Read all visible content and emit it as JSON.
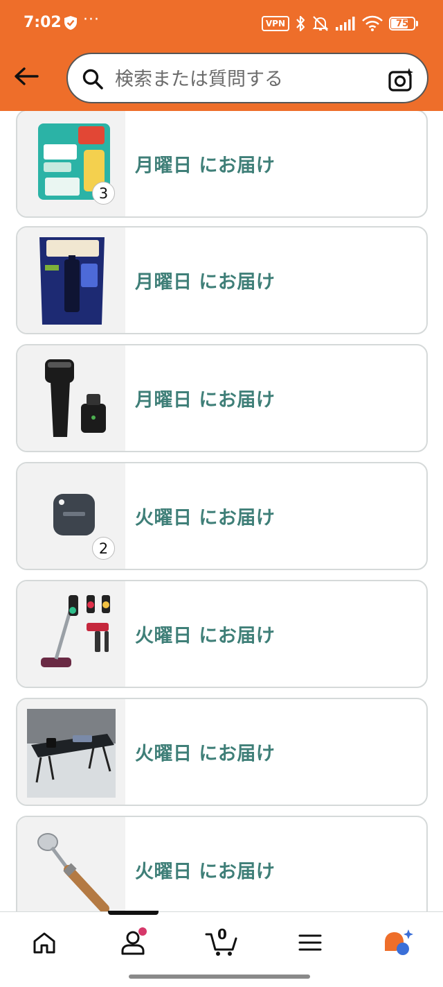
{
  "status_bar": {
    "time": "7:02",
    "dots": "···",
    "vpn": "VPN",
    "battery": "75",
    "battery_level_percent": 75
  },
  "header": {
    "search": {
      "placeholder": "検索または質問する"
    },
    "icons": {
      "back": "arrow-left-icon",
      "search": "magnifier-icon",
      "camera": "camera-lens-icon"
    }
  },
  "delivery_list": {
    "items": [
      {
        "label": "月曜日 にお届け",
        "product_icon": "detergent-refill-pack",
        "quantity": "3"
      },
      {
        "label": "月曜日 にお届け",
        "product_icon": "fabric-softener-refill-pack",
        "quantity": ""
      },
      {
        "label": "月曜日 にお届け",
        "product_icon": "electric-shaver",
        "quantity": ""
      },
      {
        "label": "火曜日 にお届け",
        "product_icon": "bluetooth-tracker-tag",
        "quantity": "2"
      },
      {
        "label": "火曜日 にお届け",
        "product_icon": "cordless-stick-vacuum",
        "quantity": ""
      },
      {
        "label": "火曜日 にお届け",
        "product_icon": "folding-table",
        "quantity": ""
      },
      {
        "label": "火曜日 にお届け",
        "product_icon": "wooden-handle-tool",
        "quantity": ""
      }
    ]
  },
  "bottom_nav": {
    "items": [
      {
        "icon": "home-icon"
      },
      {
        "icon": "profile-icon",
        "active": true
      },
      {
        "icon": "cart-icon",
        "count": "0"
      },
      {
        "icon": "menu-icon"
      },
      {
        "icon": "assistant-icon"
      }
    ]
  },
  "colors": {
    "header_bg": "#ee6e2a",
    "delivery_text": "#3f7f78",
    "card_border": "#d5d9d9",
    "badge_pink": "#d6386a",
    "assistant_orange": "#ee6e2a",
    "assistant_blue": "#3a6fd8"
  }
}
